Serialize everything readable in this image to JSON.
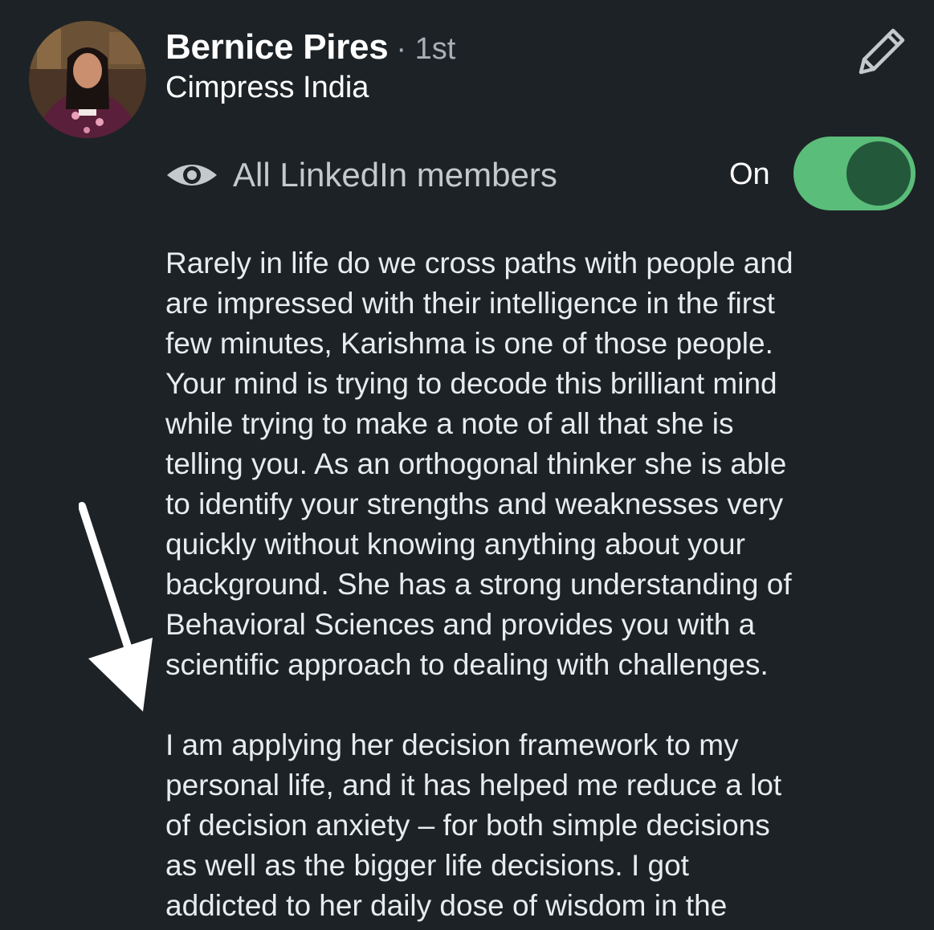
{
  "author": {
    "name": "Bernice Pires",
    "degree": "· 1st",
    "company": "Cimpress India",
    "avatar_icon": "profile-photo"
  },
  "visibility": {
    "icon": "eye-icon",
    "label": "All LinkedIn members",
    "toggle_label": "On",
    "toggle_state": true
  },
  "edit": {
    "icon": "pencil-icon"
  },
  "recommendation": {
    "paragraph1_lines": [
      "Rarely in life do we cross paths with people and",
      "are impressed with their intelligence in the first",
      "few minutes, Karishma is one of those people.",
      "Your mind is trying to decode this brilliant mind",
      "while trying to make a note of all that she is",
      "telling you. As an orthogonal thinker she is able",
      "to identify your strengths and weaknesses very",
      "quickly without knowing anything about your",
      "background. She has a strong understanding of",
      "Behavioral Sciences and provides you with a",
      "scientific approach to dealing with challenges."
    ],
    "paragraph2_lines": [
      "I am applying her decision framework to my",
      "personal life, and it has helped me reduce a lot",
      "of decision anxiety – for both simple decisions",
      "as well as the bigger life decisions. I got",
      "addicted to her daily dose of wisdom in the"
    ]
  },
  "colors": {
    "background": "#1d2226",
    "toggle_track": "#5abd79",
    "toggle_knob": "#24583b",
    "muted_text": "#a8b0b6"
  }
}
